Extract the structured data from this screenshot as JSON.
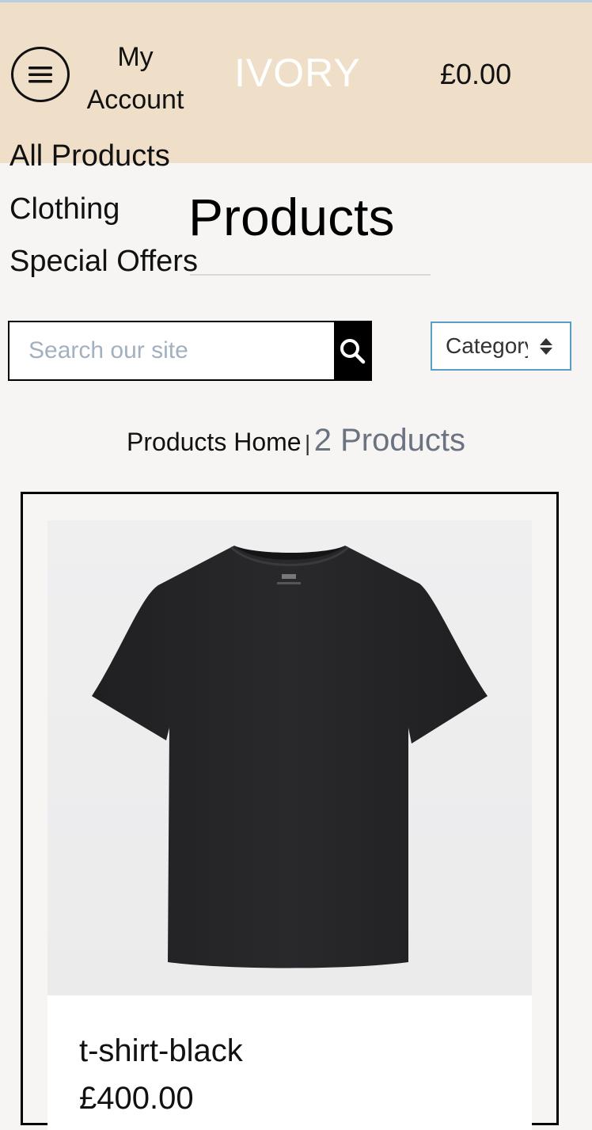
{
  "header": {
    "menu_icon": "hamburger-menu-icon",
    "account_line1": "My",
    "account_line2": "Account",
    "brand": "IVORY",
    "cart_total": "£0.00",
    "background_color": "#efdfc9"
  },
  "nav": {
    "items": [
      {
        "label": "All Products"
      },
      {
        "label": "Clothing"
      },
      {
        "label": "Special Offers"
      }
    ]
  },
  "page": {
    "title": "Products"
  },
  "search": {
    "placeholder": "Search our site",
    "value": "",
    "button_icon": "magnifier-icon"
  },
  "category_select": {
    "selected": "Category",
    "arrow_icon": "sort-arrows-icon"
  },
  "breadcrumb": {
    "home": "Products Home",
    "separator": "|",
    "count": "2 Products"
  },
  "products": [
    {
      "name": "t-shirt-black",
      "price": "£400.00",
      "image": "black crew-neck t-shirt"
    }
  ]
}
